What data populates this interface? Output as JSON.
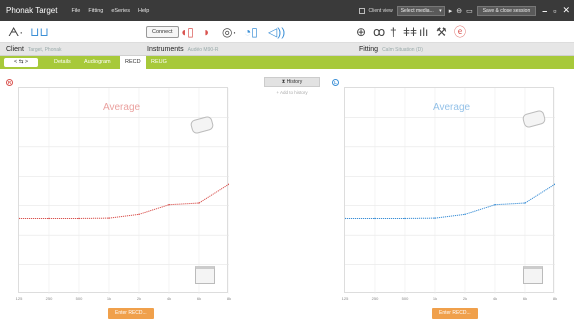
{
  "titlebar": {
    "app_name": "Phonak Target",
    "menu": [
      "File",
      "Fitting",
      "eSeries",
      "Help"
    ],
    "client_view_label": "Client view",
    "select_media_label": "Select media...",
    "save_close_label": "Save & close session"
  },
  "toolbar": {
    "connect_label": "Connect"
  },
  "header": {
    "client_title": "Client",
    "client_sub": "Target, Phonak",
    "instruments_title": "Instruments",
    "instruments_sub": "Audéo M90-R",
    "fitting_title": "Fitting",
    "fitting_sub": "Calm Situation (D)"
  },
  "tabs": {
    "nav_arrows": "< ⇆ >",
    "items": [
      "Details",
      "Audiogram",
      "RECD",
      "REUG"
    ],
    "active_index": 2
  },
  "middle": {
    "history_label": "History",
    "add_to_history_label": "+ Add to history"
  },
  "left_panel": {
    "marker": "R",
    "color": "#d9534f",
    "avg_label": "Average",
    "enter_button": "Enter RECD..."
  },
  "right_panel": {
    "marker": "L",
    "color": "#3b8fd6",
    "avg_label": "Average",
    "enter_button": "Enter RECD..."
  },
  "chart_data": [
    {
      "type": "line",
      "series": [
        {
          "values": [
            2,
            2,
            2,
            2.1,
            3.2,
            6,
            6.5,
            12
          ]
        }
      ],
      "x": [
        "125",
        "250",
        "500",
        "1k",
        "2k",
        "4k",
        "6k",
        "8k"
      ],
      "yticks": [
        "",
        "",
        "",
        "",
        "",
        "",
        ""
      ],
      "grid": true
    },
    {
      "type": "line",
      "series": [
        {
          "values": [
            2,
            2,
            2,
            2.1,
            3.2,
            6,
            6.5,
            12
          ]
        }
      ],
      "x": [
        "125",
        "250",
        "500",
        "1k",
        "2k",
        "4k",
        "6k",
        "8k"
      ],
      "yticks": [
        "",
        "",
        "",
        "",
        "",
        "",
        ""
      ],
      "grid": true
    }
  ]
}
